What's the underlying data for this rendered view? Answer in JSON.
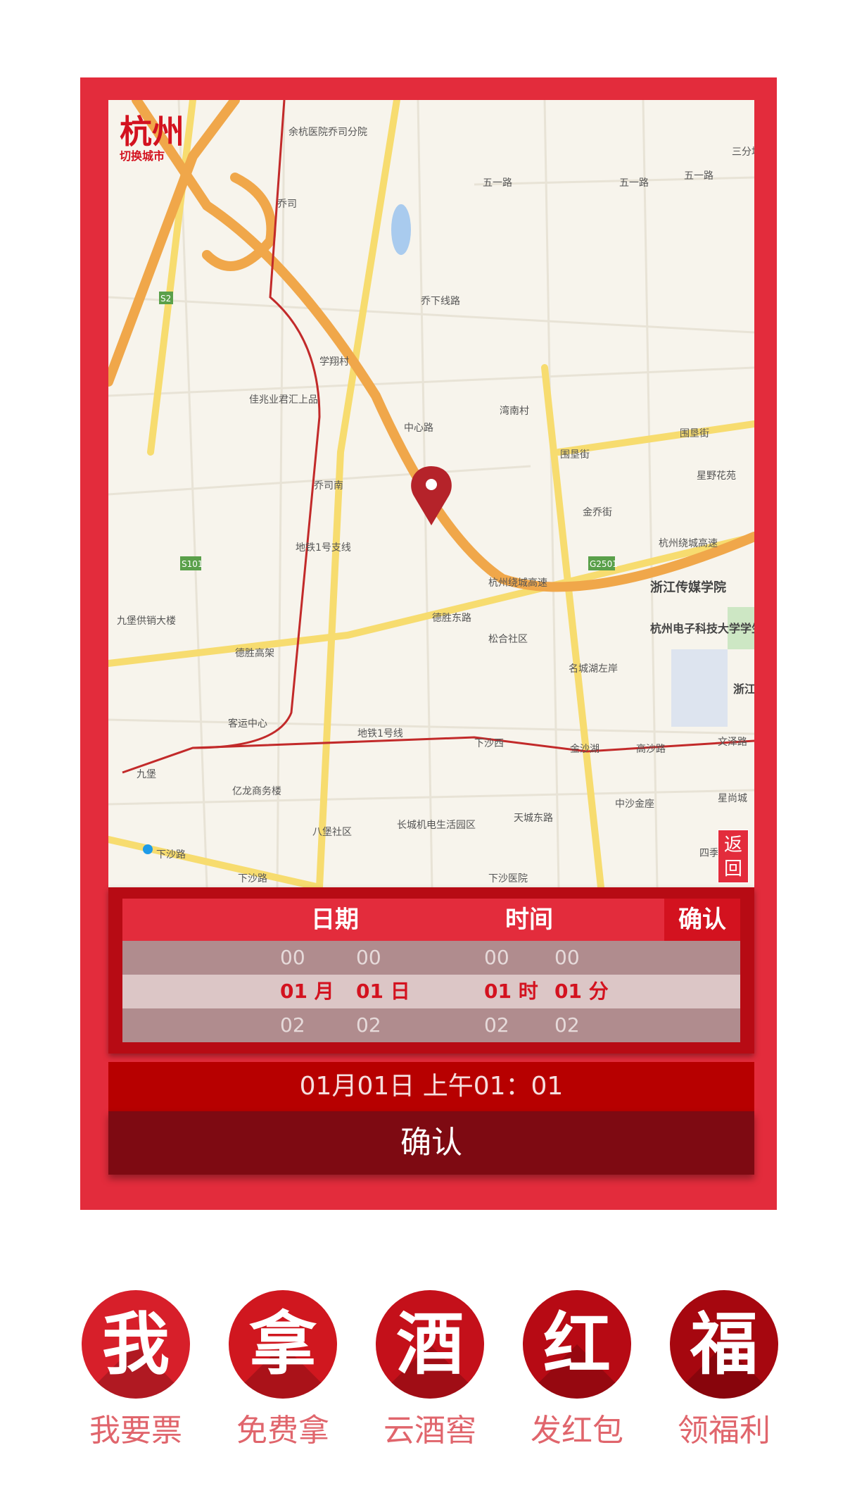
{
  "map": {
    "city": "杭州",
    "switch_city": "切换城市",
    "back_button": "返回",
    "labels": [
      "余杭医院乔司分院",
      "乔司",
      "五一路",
      "五一路",
      "五一路",
      "三分场",
      "乔下线路",
      "学翔村",
      "佳兆业君汇上品",
      "中心路",
      "湾南村",
      "围垦街",
      "围垦街",
      "星野花苑",
      "乔司南",
      "金乔街",
      "地铁1号支线",
      "杭州绕城高速",
      "杭州绕城高速",
      "浙江传媒学院",
      "九堡供销大楼",
      "杭州电子科技大学学生生活区",
      "松合社区",
      "德胜东路",
      "德胜高架",
      "名城湖左岸",
      "客运中心",
      "地铁1号线",
      "下沙西",
      "金沙湖",
      "高沙路",
      "文泽路",
      "九堡",
      "亿龙商务楼",
      "中沙金座",
      "星尚城",
      "八堡社区",
      "长城机电生活园区",
      "天城东路",
      "四季",
      "下沙路",
      "下沙路",
      "下沙医院",
      "浙江下沙"
    ],
    "shields": [
      "S2",
      "S101",
      "G2501"
    ]
  },
  "picker": {
    "date_label": "日期",
    "time_label": "时间",
    "confirm_label": "确认",
    "rows": {
      "top": [
        "00",
        "00",
        "00",
        "00"
      ],
      "selected": [
        "01 月",
        "01 日",
        "01 时",
        "01 分"
      ],
      "bottom": [
        "02",
        "02",
        "02",
        "02"
      ]
    }
  },
  "summary_text": "01月01日 上午01：01",
  "confirm_button": "确认",
  "nav": [
    {
      "glyph": "我",
      "label": "我要票",
      "color": "#d71f2a"
    },
    {
      "glyph": "拿",
      "label": "免费拿",
      "color": "#d0171f"
    },
    {
      "glyph": "酒",
      "label": "云酒窖",
      "color": "#c4101a"
    },
    {
      "glyph": "红",
      "label": "发红包",
      "color": "#b70a14"
    },
    {
      "glyph": "福",
      "label": "领福利",
      "color": "#a6070f"
    }
  ],
  "colors": {
    "card": "#e32c3c",
    "confirm_dark": "#7e0a12",
    "summary": "#b70000",
    "nav_label": "#e0656c"
  }
}
